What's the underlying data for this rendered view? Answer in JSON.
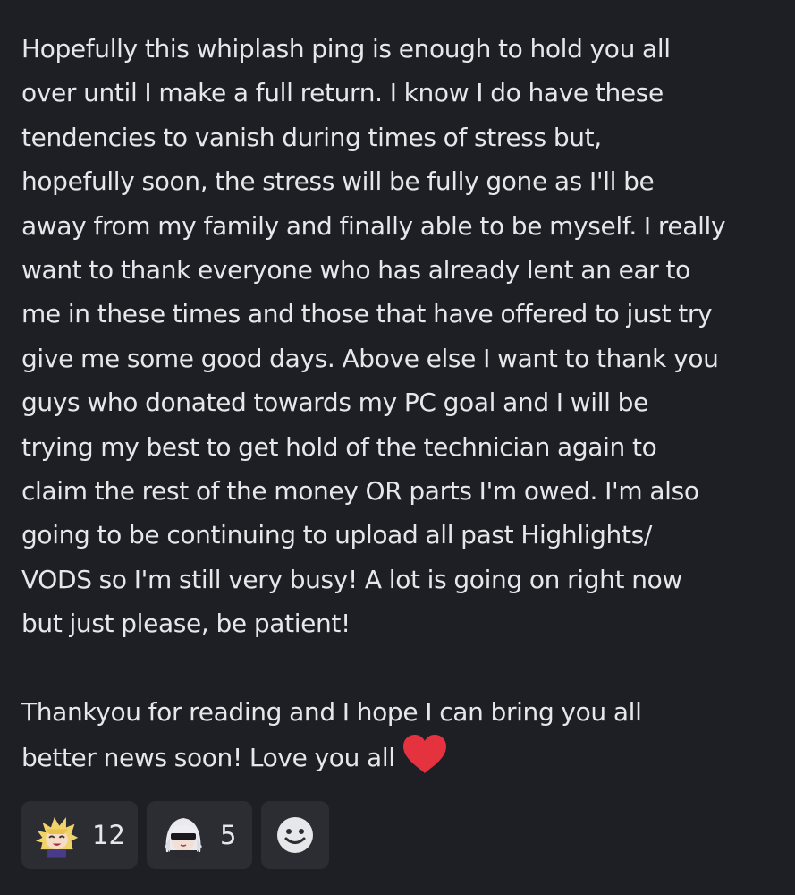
{
  "message": {
    "lines": [
      "Hopefully this whiplash ping is enough to hold you all",
      "over until I make a full return. I know I do have these",
      "tendencies to vanish during times of stress but,",
      "hopefully soon, the stress will be fully gone as I'll be",
      "away from my family and finally able to be myself. I really",
      "want to thank everyone who has already lent an ear to",
      "me in these times and those that have offered to just try",
      "give me some good days. Above else I want to thank you",
      "guys who donated towards my PC goal and I will be",
      "trying my best to get hold of the technician again to",
      "claim the rest of the money OR parts I'm owed. I'm also",
      "going to be continuing to upload all past Highlights/",
      "VODS so I'm still very busy! A lot is going on right now",
      "but just please, be patient!"
    ],
    "closing_lines": [
      "Thankyou for reading and I hope I can bring you all",
      "better news soon! Love you all"
    ],
    "heart_icon": "red-heart-emoji",
    "heart_color": "#e5323f"
  },
  "reactions": [
    {
      "emoji": "blonde-anime-character-emoji",
      "count": "12"
    },
    {
      "emoji": "white-haired-blindfold-character-emoji",
      "count": "5"
    }
  ],
  "add_reaction_icon": "smiley-face-icon",
  "colors": {
    "background": "#1e1f24",
    "text": "#e6e7ea",
    "reaction_background": "#2b2d33"
  }
}
